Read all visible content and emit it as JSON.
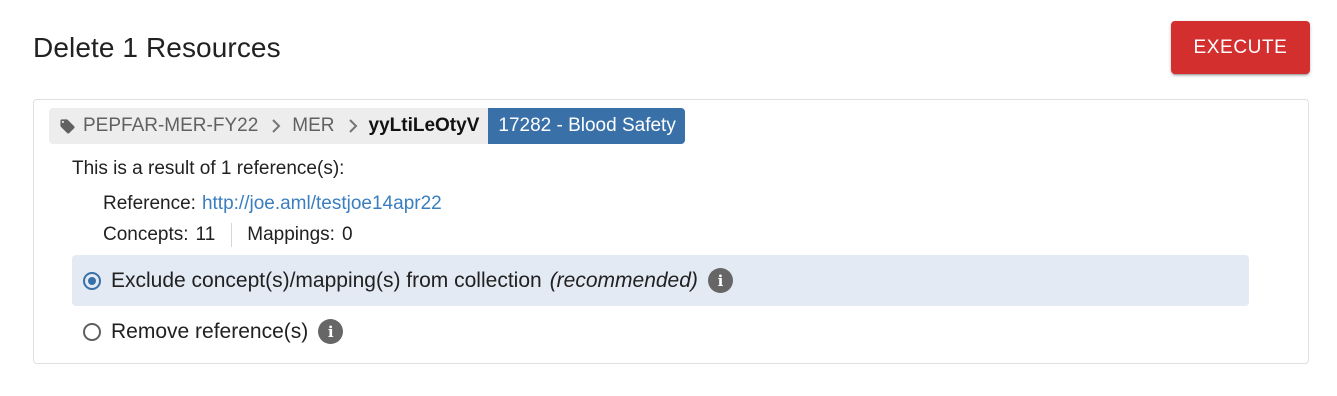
{
  "page": {
    "title": "Delete 1 Resources"
  },
  "actions": {
    "execute_label": "EXECUTE"
  },
  "breadcrumb": {
    "tag_icon": "tag-icon",
    "source": "PEPFAR-MER-FY22",
    "collection": "MER",
    "id": "yyLtiLeOtyV",
    "resource_label": "17282 - Blood Safety",
    "separator_icon": "chevron-right-icon"
  },
  "result": {
    "text": "This is a result of 1 reference(s):",
    "reference_label": "Reference:",
    "reference_url": "http://joe.aml/testjoe14apr22",
    "concepts_label": "Concepts:",
    "concepts_count": "11",
    "mappings_label": "Mappings:",
    "mappings_count": "0"
  },
  "options": {
    "exclude": {
      "label": "Exclude concept(s)/mapping(s) from collection",
      "note": "(recommended)",
      "selected": true
    },
    "remove": {
      "label": "Remove reference(s)",
      "selected": false
    }
  },
  "colors": {
    "execute_bg": "#d32f2f",
    "resource_badge_bg": "#3a70a8",
    "selected_option_bg": "#e3eaf3",
    "link": "#3a7ebf"
  }
}
